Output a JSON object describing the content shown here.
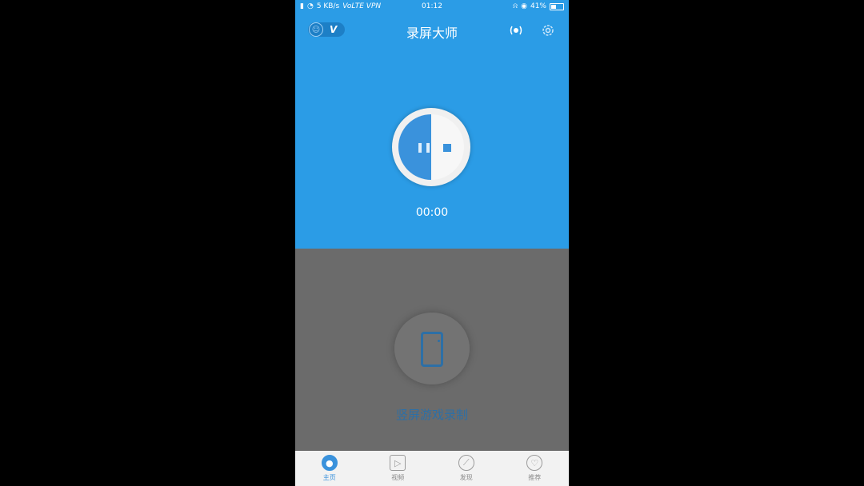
{
  "status_bar": {
    "signal": "4G",
    "speed": "5 KB/s",
    "network": "VoLTE VPN",
    "time": "01:12",
    "battery": "41%"
  },
  "header": {
    "title": "录屏大师",
    "vip_label": "V"
  },
  "recorder": {
    "timer": "00:00"
  },
  "feature": {
    "label": "竖屏游戏录制"
  },
  "tabs": [
    {
      "label": "主页",
      "icon": "home-icon",
      "active": true
    },
    {
      "label": "视频",
      "icon": "video-icon",
      "active": false
    },
    {
      "label": "发现",
      "icon": "compass-icon",
      "active": false
    },
    {
      "label": "推荐",
      "icon": "heart-icon",
      "active": false
    }
  ],
  "colors": {
    "primary": "#2b9ce6",
    "accent": "#3a92dc",
    "overlay": "#6b6b6b"
  }
}
